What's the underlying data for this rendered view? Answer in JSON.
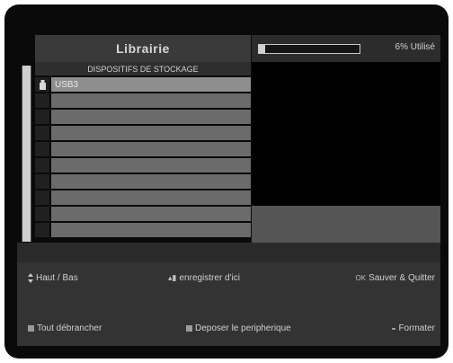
{
  "library": {
    "title": "Librairie",
    "usage_text": "6% Utilisé",
    "usage_fraction": 0.06
  },
  "list": {
    "header": "DISPOSITIFS DE STOCKAGE",
    "rows": [
      {
        "label": "USB3",
        "selected": true
      },
      {
        "label": "",
        "selected": false
      },
      {
        "label": "",
        "selected": false
      },
      {
        "label": "",
        "selected": false
      },
      {
        "label": "",
        "selected": false
      },
      {
        "label": "",
        "selected": false
      },
      {
        "label": "",
        "selected": false
      },
      {
        "label": "",
        "selected": false
      },
      {
        "label": "",
        "selected": false
      },
      {
        "label": "",
        "selected": false
      }
    ]
  },
  "help": {
    "nav": "Haut / Bas",
    "record_here": "enregistrer d'ici",
    "save_quit": "Sauver & Quitter",
    "unplug_all": "Tout débrancher",
    "eject": "Deposer le peripherique",
    "format": "Formater"
  },
  "icons": {
    "usb": "usb-icon",
    "updown": "updown-icon",
    "record": "record-icon",
    "ok": "ok-icon"
  }
}
